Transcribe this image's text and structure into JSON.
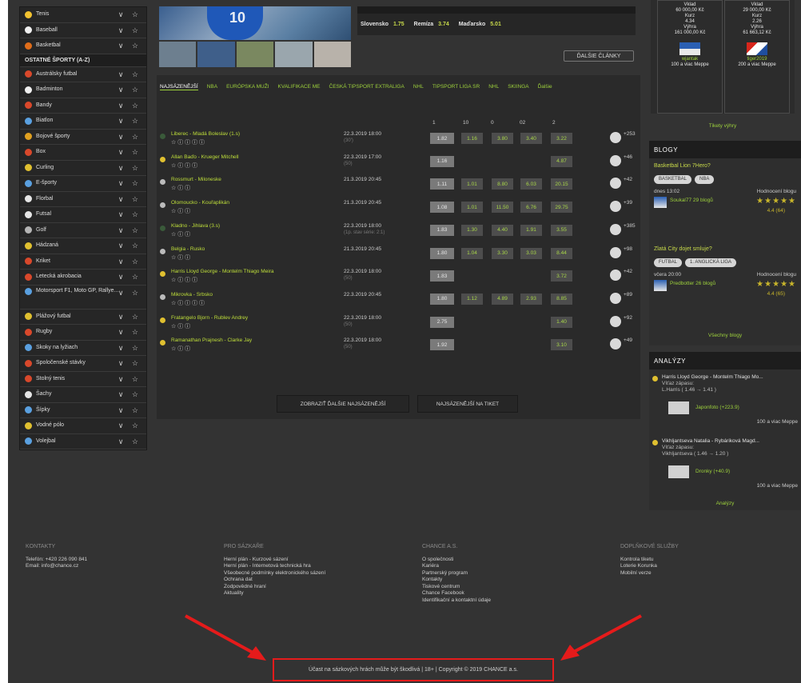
{
  "sidebar": {
    "items_top": [
      {
        "label": "Tenis",
        "color": "#f2c230"
      },
      {
        "label": "Baseball",
        "color": "#f0f0f0"
      },
      {
        "label": "Basketbal",
        "color": "#e06d1a"
      }
    ],
    "section_title": "OSTATNÉ ŠPORTY (A-Z)",
    "items": [
      {
        "label": "Austrálsky futbal",
        "color": "#d9482b"
      },
      {
        "label": "Badminton",
        "color": "#f0f0f0"
      },
      {
        "label": "Bandy",
        "color": "#d9482b"
      },
      {
        "label": "Biatlon",
        "color": "#5aa0e0"
      },
      {
        "label": "Bojové športy",
        "color": "#e0a020"
      },
      {
        "label": "Box",
        "color": "#d9482b"
      },
      {
        "label": "Curling",
        "color": "#e0c030"
      },
      {
        "label": "E-športy",
        "color": "#5aa0e0"
      },
      {
        "label": "Florbal",
        "color": "#e6e6e6"
      },
      {
        "label": "Futsal",
        "color": "#e6e6e6"
      },
      {
        "label": "Golf",
        "color": "#b5b5b5"
      },
      {
        "label": "Hádzaná",
        "color": "#e0c030"
      },
      {
        "label": "Kriket",
        "color": "#d9482b"
      },
      {
        "label": "Letecká akrobacia",
        "color": "#d9482b"
      },
      {
        "label": "Motorsport F1, Moto GP, Rallye...",
        "color": "#5aa0e0",
        "tall": true
      },
      {
        "label": "Plážový futbal",
        "color": "#e0c030"
      },
      {
        "label": "Rugby",
        "color": "#d9482b"
      },
      {
        "label": "Skoky na lyžiach",
        "color": "#5aa0e0"
      },
      {
        "label": "Spoločenské stávky",
        "color": "#d9482b"
      },
      {
        "label": "Stolný tenis",
        "color": "#d9482b"
      },
      {
        "label": "Šachy",
        "color": "#e6e6e6"
      },
      {
        "label": "Šípky",
        "color": "#5aa0e0"
      },
      {
        "label": "Vodné pólo",
        "color": "#e0c030"
      },
      {
        "label": "Volejbal",
        "color": "#5aa0e0"
      }
    ],
    "ctrl": "∨ ☆"
  },
  "news": {
    "jersey_number": "10",
    "odds": [
      {
        "team": "Slovensko",
        "odd": "1.75"
      },
      {
        "team": "Remíza",
        "odd": "3.74"
      },
      {
        "team": "Maďarsko",
        "odd": "5.01"
      }
    ],
    "more_label": "ĎALŠIE ČLÁNKY"
  },
  "tabs": [
    "NAJSÁZENĚJŠÍ",
    "NBA",
    "EURÓPSKA MUŽI",
    "KVALIFIKACE ME",
    "ČESKÁ TIPSPORT EXTRALIGA",
    "NHL",
    "TIPSPORT LIGA SR",
    "NHL",
    "SKIINGA",
    "Ďalšie"
  ],
  "columns": [
    "1",
    "10",
    "0",
    "02",
    "2"
  ],
  "matches": [
    {
      "name": "Liberec - Mladá Boleslav (1.s)",
      "date": "22.3.2019  18:00",
      "sub": "(30')",
      "icons": "☆ ⓘ ⓘ ⓘ ⓘ",
      "odds": [
        "1.82",
        "1.16",
        "3.80",
        "3.40",
        "3.22"
      ],
      "more": "+253",
      "dot": "#3a5a3a"
    },
    {
      "name": "Allan Baďo - Krueger Mitchell",
      "date": "22.3.2019  17:00",
      "sub": "(50)",
      "icons": "☆ ⓘ ⓘ ⓘ",
      "odds": [
        "1.16",
        "",
        "",
        "",
        "4.87"
      ],
      "more": "+46",
      "dot": "#e0c030"
    },
    {
      "name": "Rossmurt - Miloneske",
      "date": "21.3.2019  20:45",
      "sub": "",
      "icons": "☆ ⓘ ⓘ",
      "odds": [
        "1.11",
        "1.01",
        "8.80",
        "6.03",
        "20.15"
      ],
      "more": "+42",
      "dot": "#bbbbbb"
    },
    {
      "name": "Olomoucko - Kouřaplikán",
      "date": "21.3.2019  20:45",
      "sub": "",
      "icons": "☆ ⓘ ⓘ",
      "odds": [
        "1.08",
        "1.01",
        "11.50",
        "6.76",
        "29.75"
      ],
      "more": "+39",
      "dot": "#bbbbbb"
    },
    {
      "name": "Kladno - Jihlava (3.s)",
      "date": "22.3.2019  18:00",
      "sub": "(1p. stav série: 2:1)",
      "icons": "☆ ⓘ ⓘ",
      "odds": [
        "1.83",
        "1.30",
        "4.40",
        "1.91",
        "3.55"
      ],
      "more": "+385",
      "dot": "#3a5a3a"
    },
    {
      "name": "Belgia - Rusko",
      "date": "21.3.2019  20:45",
      "sub": "",
      "icons": "☆ ⓘ ⓘ",
      "odds": [
        "1.80",
        "1.04",
        "3.30",
        "3.03",
        "8.44"
      ],
      "more": "+98",
      "dot": "#bbbbbb"
    },
    {
      "name": "Harris Lloyd George - Montelm Thiago Meira",
      "date": "22.3.2019  18:00",
      "sub": "(50)",
      "icons": "☆ ⓘ ⓘ ⓘ",
      "odds": [
        "1.83",
        "",
        "",
        "",
        "3.72"
      ],
      "more": "+42",
      "dot": "#e0c030"
    },
    {
      "name": "Mikrovka - Srbsko",
      "date": "22.3.2019  20:45",
      "sub": "",
      "icons": "☆ ⓘ ⓘ ⓘ ⓘ",
      "odds": [
        "1.80",
        "1.12",
        "4.89",
        "2.93",
        "8.85"
      ],
      "more": "+89",
      "dot": "#bbbbbb"
    },
    {
      "name": "Fratangelo Bjorn - Rublev Andrey",
      "date": "22.3.2019  18:00",
      "sub": "(50)",
      "icons": "☆ ⓘ ⓘ",
      "odds": [
        "2.75",
        "",
        "",
        "",
        "1.40"
      ],
      "more": "+92",
      "dot": "#e0c030"
    },
    {
      "name": "Ramanathan Prajnesh - Clarke Jay",
      "date": "22.3.2019  18:00",
      "sub": "(50)",
      "icons": "☆ ⓘ ⓘ",
      "odds": [
        "1.92",
        "",
        "",
        "",
        "3.10"
      ],
      "more": "+49",
      "dot": "#e0c030"
    }
  ],
  "buttons": {
    "more": "ZOBRAZIŤ ĎALŠIE NAJSÁZENĚJŠÍ",
    "ticket": "NAJSÁZENĚJŠÍ NA TIKET"
  },
  "right": {
    "cards": [
      {
        "lines": [
          "Vklad",
          "60 000,00 Kč",
          "Kurz",
          "4.34",
          "Výhra",
          "161 000,00 Kč"
        ],
        "name": "wjantak",
        "caption": "100 a viac Meppe"
      },
      {
        "lines": [
          "Vklad",
          "29 000,00 Kč",
          "Kurz",
          "2.26",
          "Výhra",
          "61 663,12 Kč"
        ],
        "name": "tiger2019",
        "caption": "200 a viac Meppe"
      }
    ],
    "filter": "Tikety výhry",
    "blogs_title": "BLOGY",
    "blogs": [
      {
        "title": "Basketbal Lion 7Hero?",
        "tags": [
          "BASKETBAL",
          "NBA"
        ],
        "date": "dnes 13:02",
        "author": "Soukal77 29 blogů",
        "rating_label": "Hodnocení blogu",
        "stars": "★★★★★",
        "rating": "4.4  (64)"
      },
      {
        "title": "Zlatá City dojet smluje?",
        "tags": [
          "FUTBAL",
          "1. ANGLICKÁ LIGA"
        ],
        "date": "včera 20:00",
        "author": "Predbotter 26 blogů",
        "rating_label": "Hodnocení blogu",
        "stars": "★★★★★",
        "rating": "4.4  (65)"
      }
    ],
    "all_blogs": "Všechny blogy",
    "analyses_title": "ANALÝZY",
    "analyses": [
      {
        "title": "Harris Lloyd George - Montelm Thiago Mo...",
        "sub1": "Víťaz zápasu:",
        "sub2": "L.Harris ( 1.46 → 1.41 )",
        "author": "Japonfoto (+223.9)",
        "caption": "100 a viac Meppe"
      },
      {
        "title": "Vikhljantseva Natalia - Rybáriková Magd...",
        "sub1": "Víťaz zápasu:",
        "sub2": "Vikhljantseva ( 1.46 → 1.20 )",
        "author": "Dronky (+40.9)",
        "caption": "100 a viac Meppe"
      }
    ],
    "all_analyses": "Analýzy"
  },
  "footer": {
    "cols": [
      {
        "title": "KONTAKTY",
        "items": [
          "Telefón: +420 226 090 841",
          "Email: info@chance.cz"
        ]
      },
      {
        "title": "PRO SÁZKAŘE",
        "items": [
          "Herní plán - Kurzové sázení",
          "Herní plán - Internetová technická hra",
          "Všeobecné podmínky elektronického sázení",
          "Ochrana dat",
          "Zodpovědné hraní",
          "Aktuality"
        ]
      },
      {
        "title": "CHANCE A.S.",
        "items": [
          "O společnosti",
          "Kariéra",
          "Partnerský program",
          "Kontakty",
          "Tiskové centrum",
          "Chance Facebook",
          "Identifikační a kontaktní údaje"
        ]
      },
      {
        "title": "DOPLŇKOVÉ SLUŽBY",
        "items": [
          "Kontrola tiketu",
          "Loterie Korunka",
          "Mobilní verze"
        ]
      }
    ],
    "copyright": "Účast na sázkových hrách může být škodlivá | 18+ | Copyright © 2019 CHANCE a.s."
  }
}
